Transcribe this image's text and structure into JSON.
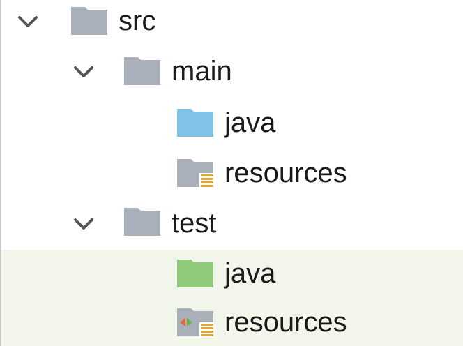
{
  "tree": {
    "src": {
      "label": "src",
      "expanded": true,
      "icon": "folder-icon"
    },
    "main": {
      "label": "main",
      "expanded": true,
      "icon": "folder-icon"
    },
    "main_java": {
      "label": "java",
      "icon": "source-root-folder-icon",
      "color": "#7fc4e6"
    },
    "main_resources": {
      "label": "resources",
      "icon": "resources-root-folder-icon"
    },
    "test": {
      "label": "test",
      "expanded": true,
      "icon": "folder-icon"
    },
    "test_java": {
      "label": "java",
      "icon": "test-source-root-folder-icon",
      "color": "#8fc97a"
    },
    "test_resources": {
      "label": "resources",
      "icon": "test-resources-root-folder-icon"
    }
  },
  "colors": {
    "folder_gray": "#aab0ba",
    "folder_blue": "#7fc4e6",
    "folder_green": "#8fc97a",
    "resources_stripes": "#e0a63a",
    "test_highlight": "#f2f6ea"
  }
}
